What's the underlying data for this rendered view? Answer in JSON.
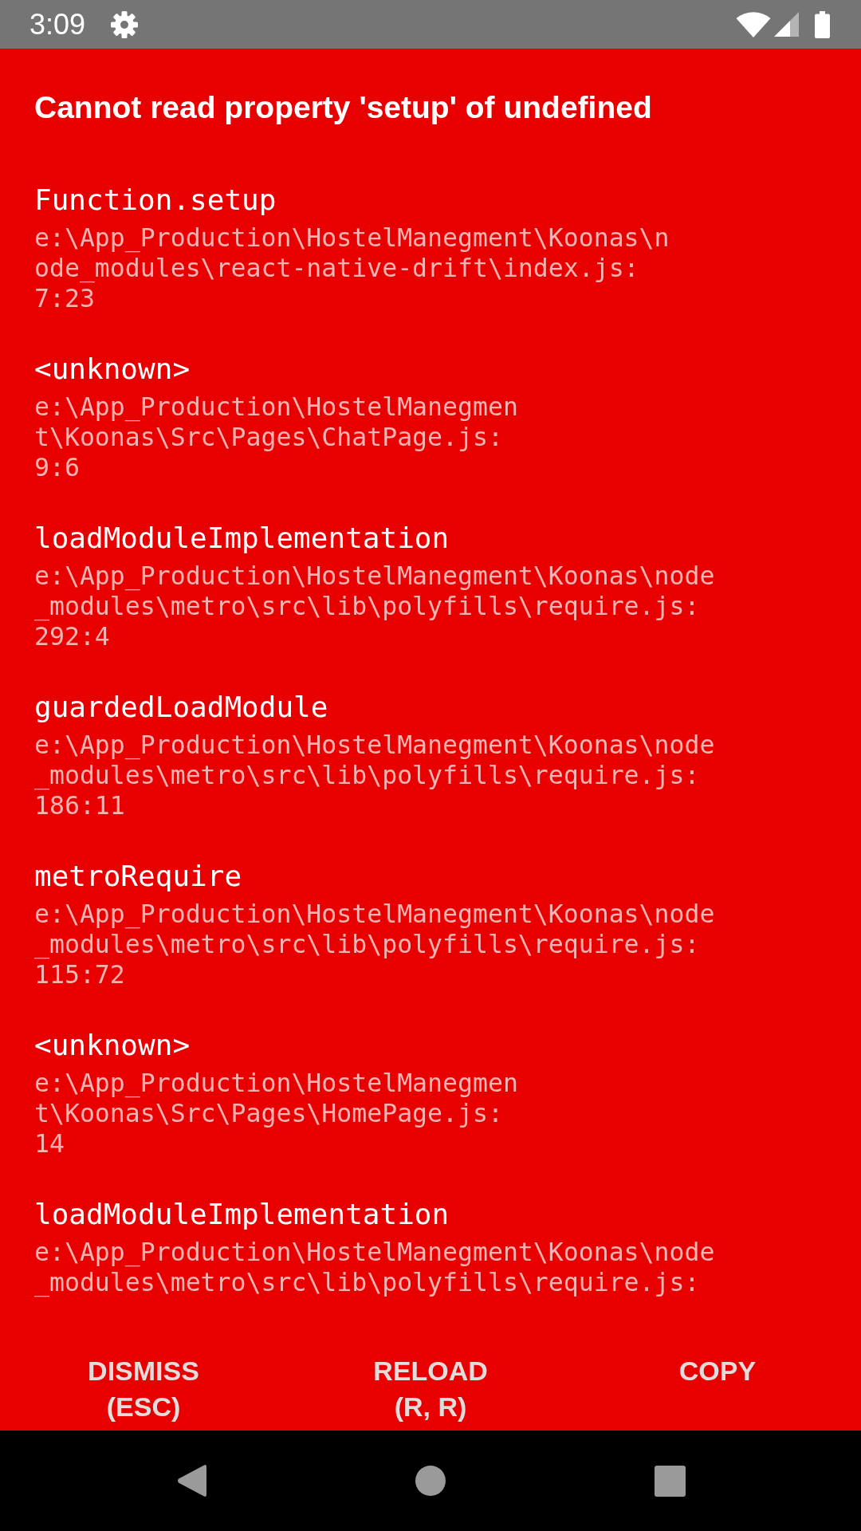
{
  "status_bar": {
    "time": "3:09"
  },
  "error": {
    "message": "Cannot read property 'setup' of undefined"
  },
  "stack": [
    {
      "method": "Function.setup",
      "location": [
        "e:\\App_Production\\HostelManegment\\Koonas\\n",
        "ode_modules\\react-native-drift\\index.js:",
        "7:23"
      ]
    },
    {
      "method": "<unknown>",
      "location": [
        "e:\\App_Production\\HostelManegmen",
        "t\\Koonas\\Src\\Pages\\ChatPage.js:",
        "9:6"
      ]
    },
    {
      "method": "loadModuleImplementation",
      "location": [
        "e:\\App_Production\\HostelManegment\\Koonas\\node",
        "_modules\\metro\\src\\lib\\polyfills\\require.js:",
        "292:4"
      ]
    },
    {
      "method": "guardedLoadModule",
      "location": [
        "e:\\App_Production\\HostelManegment\\Koonas\\node",
        "_modules\\metro\\src\\lib\\polyfills\\require.js:",
        "186:11"
      ]
    },
    {
      "method": "metroRequire",
      "location": [
        "e:\\App_Production\\HostelManegment\\Koonas\\node",
        "_modules\\metro\\src\\lib\\polyfills\\require.js:",
        "115:72"
      ]
    },
    {
      "method": "<unknown>",
      "location": [
        "e:\\App_Production\\HostelManegmen",
        "t\\Koonas\\Src\\Pages\\HomePage.js:",
        "14"
      ]
    },
    {
      "method": "loadModuleImplementation",
      "location": [
        "e:\\App_Production\\HostelManegment\\Koonas\\node",
        "_modules\\metro\\src\\lib\\polyfills\\require.js:"
      ]
    }
  ],
  "buttons": [
    {
      "label": [
        "DISMISS",
        "(ESC)"
      ]
    },
    {
      "label": [
        "RELOAD",
        "(R, R)"
      ]
    },
    {
      "label": [
        "COPY"
      ]
    }
  ]
}
